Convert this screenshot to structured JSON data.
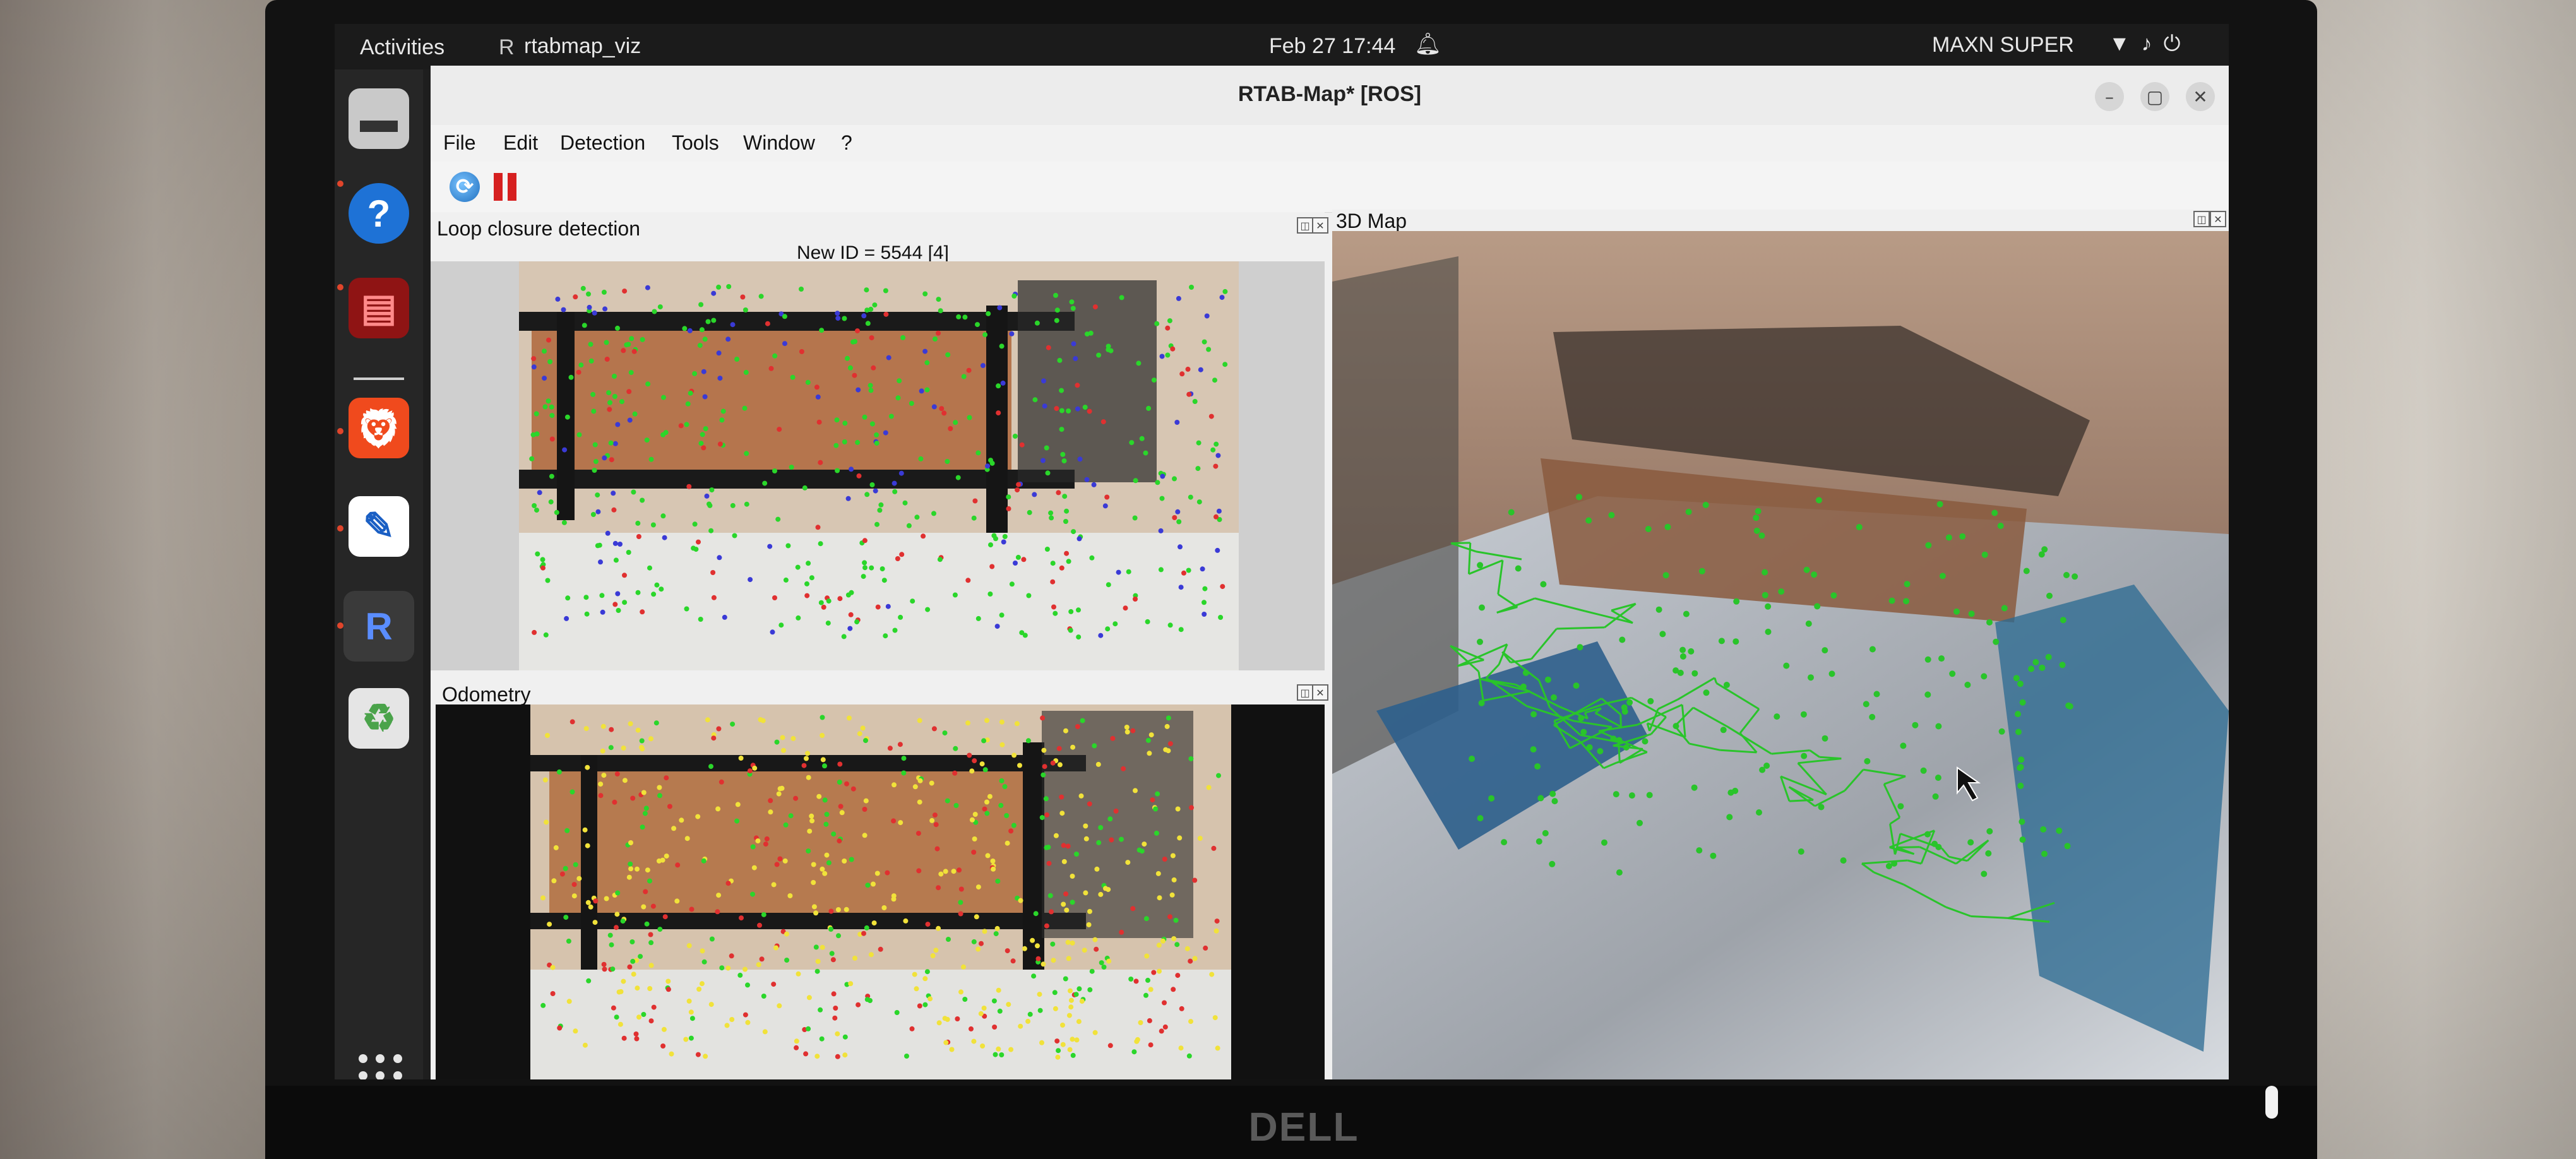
{
  "monitor": {
    "brand": "DELL"
  },
  "topbar": {
    "activities": "Activities",
    "app_name": "rtabmap_viz",
    "clock": "Feb 27  17:44",
    "power_mode": "MAXN SUPER",
    "app_icon": "rtabmap-icon",
    "bell_icon": "bell-icon",
    "tray_icons": [
      "wifi-icon",
      "volume-icon",
      "power-icon"
    ]
  },
  "dock": {
    "items": [
      {
        "name": "files-icon",
        "glyph": "▬",
        "running": false
      },
      {
        "name": "help-icon",
        "glyph": "?",
        "running": false
      },
      {
        "name": "system-monitor-icon",
        "glyph": "▤",
        "running": true
      },
      {
        "name": "brave-browser-icon",
        "glyph": "🦁",
        "running": true
      },
      {
        "name": "text-editor-icon",
        "glyph": "✎",
        "running": true
      },
      {
        "name": "rtabmap-app-icon",
        "glyph": "R",
        "running": true
      },
      {
        "name": "trash-icon",
        "glyph": "♻",
        "running": false
      }
    ],
    "show_apps_icon": "grid-icon"
  },
  "window": {
    "title": "RTAB-Map* [ROS]",
    "menu": [
      "File",
      "Edit",
      "Detection",
      "Tools",
      "Window",
      "?"
    ],
    "toolbar": {
      "refresh_icon": "refresh-icon",
      "pause_icon": "pause-icon"
    },
    "loop_panel": {
      "title": "Loop closure detection",
      "new_id_label": "New ID = 5544 [4]"
    },
    "odometry_panel": {
      "title": "Odometry"
    },
    "map_panel": {
      "title": "3D Map"
    },
    "colors": {
      "feature_green": "#2ad62a",
      "feature_red": "#e03030",
      "feature_yellow": "#f1e23a",
      "feature_blue": "#3a3ad6",
      "trajectory_green": "#29c42a"
    }
  }
}
